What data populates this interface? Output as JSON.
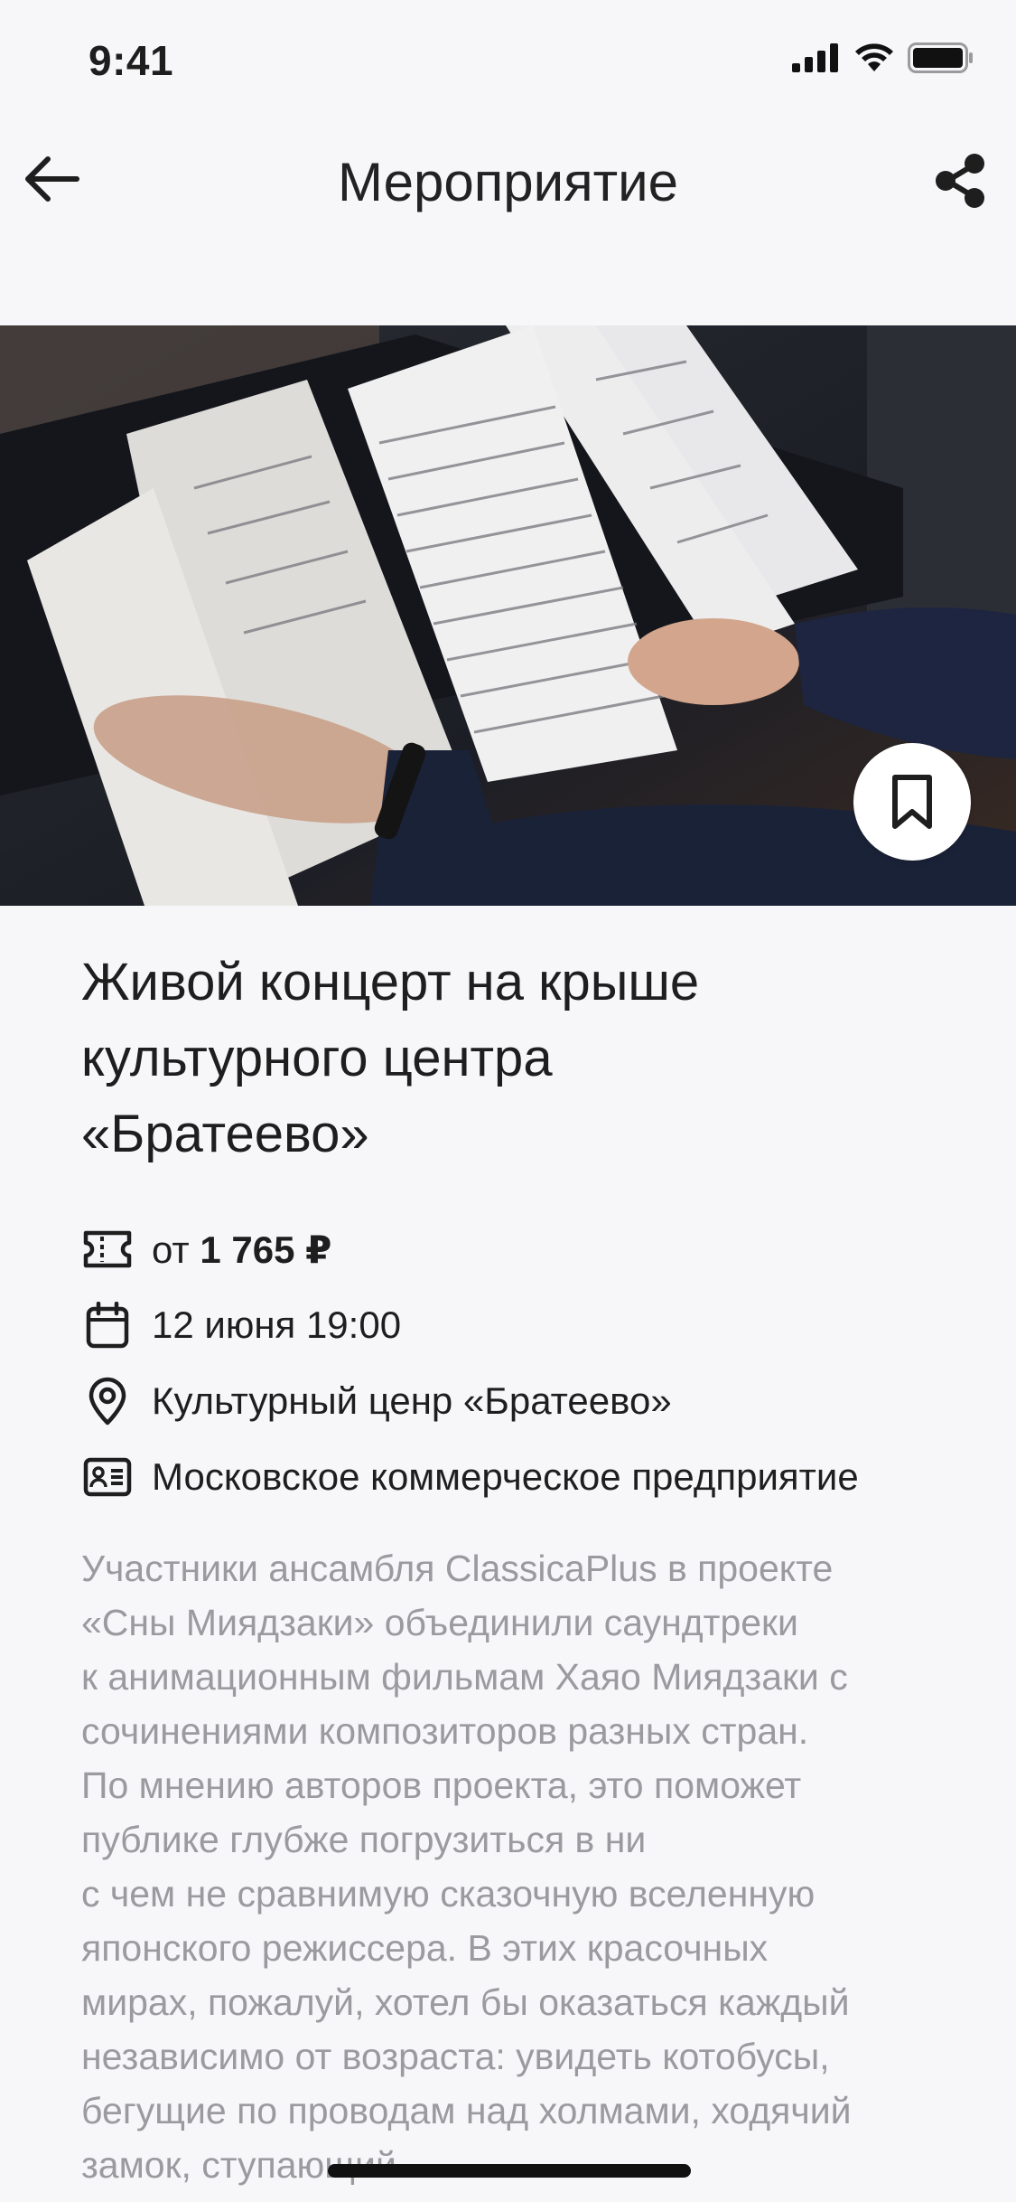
{
  "status_bar": {
    "time": "9:41"
  },
  "nav": {
    "title": "Мероприятие"
  },
  "event": {
    "title_lines": [
      "Живой концерт на крыше",
      "культурного центра",
      "«Братеево»"
    ],
    "price_prefix": "от",
    "price_value": "1 765 ₽",
    "datetime": "12 июня 19:00",
    "place": "Культурный ценр «Братеево»",
    "organizer": "Московское коммерческое предприятие"
  },
  "description_lines": [
    "Участники ансамбля ClassicaPlus в проекте",
    "«Сны Миядзаки» объединили саундтреки",
    "к анимационным фильмам Хаяо Миядзаки с",
    "сочинениями композиторов разных стран.",
    "По мнению авторов проекта, это поможет",
    "публике глубже погрузиться в ни",
    "с чем не сравнимую сказочную вселенную",
    "японского режиссера. В этих красочных",
    "мирах, пожалуй, хотел бы оказаться каждый",
    "независимо от возраста: увидеть котобусы,",
    "бегущие по проводам над холмами, ходячий",
    "замок, ступающий"
  ],
  "icons": [
    "back-arrow-icon",
    "share-icon",
    "bookmark-icon",
    "ticket-icon",
    "calendar-icon",
    "location-pin-icon",
    "id-card-icon"
  ],
  "colors": {
    "background": "#f7f7fa",
    "text": "#1e1e1e",
    "muted_text": "#9b9b9f"
  }
}
